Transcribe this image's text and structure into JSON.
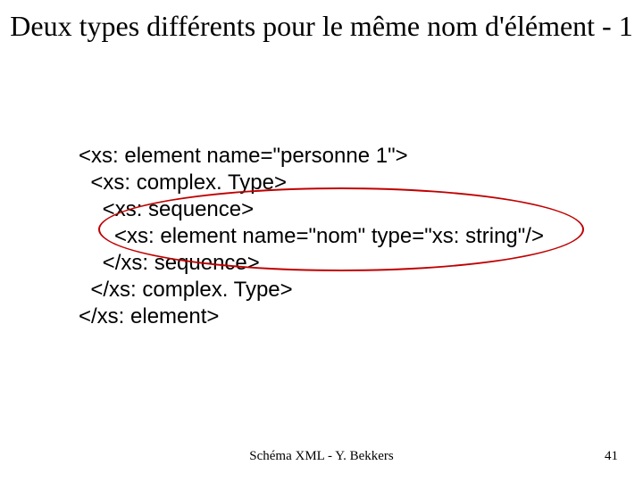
{
  "title": "Deux types différents pour le même nom d'élément - 1",
  "code": {
    "l1": "<xs: element name=\"personne 1\">",
    "l2": "  <xs: complex. Type>",
    "l3": "    <xs: sequence>",
    "l4": "      <xs: element name=\"nom\" type=\"xs: string\"/>",
    "l5": "    </xs: sequence>",
    "l6": "  </xs: complex. Type>",
    "l7": "</xs: element>"
  },
  "footer": {
    "center": "Schéma XML - Y. Bekkers",
    "page": "41"
  },
  "highlight": {
    "color": "#c00000"
  }
}
